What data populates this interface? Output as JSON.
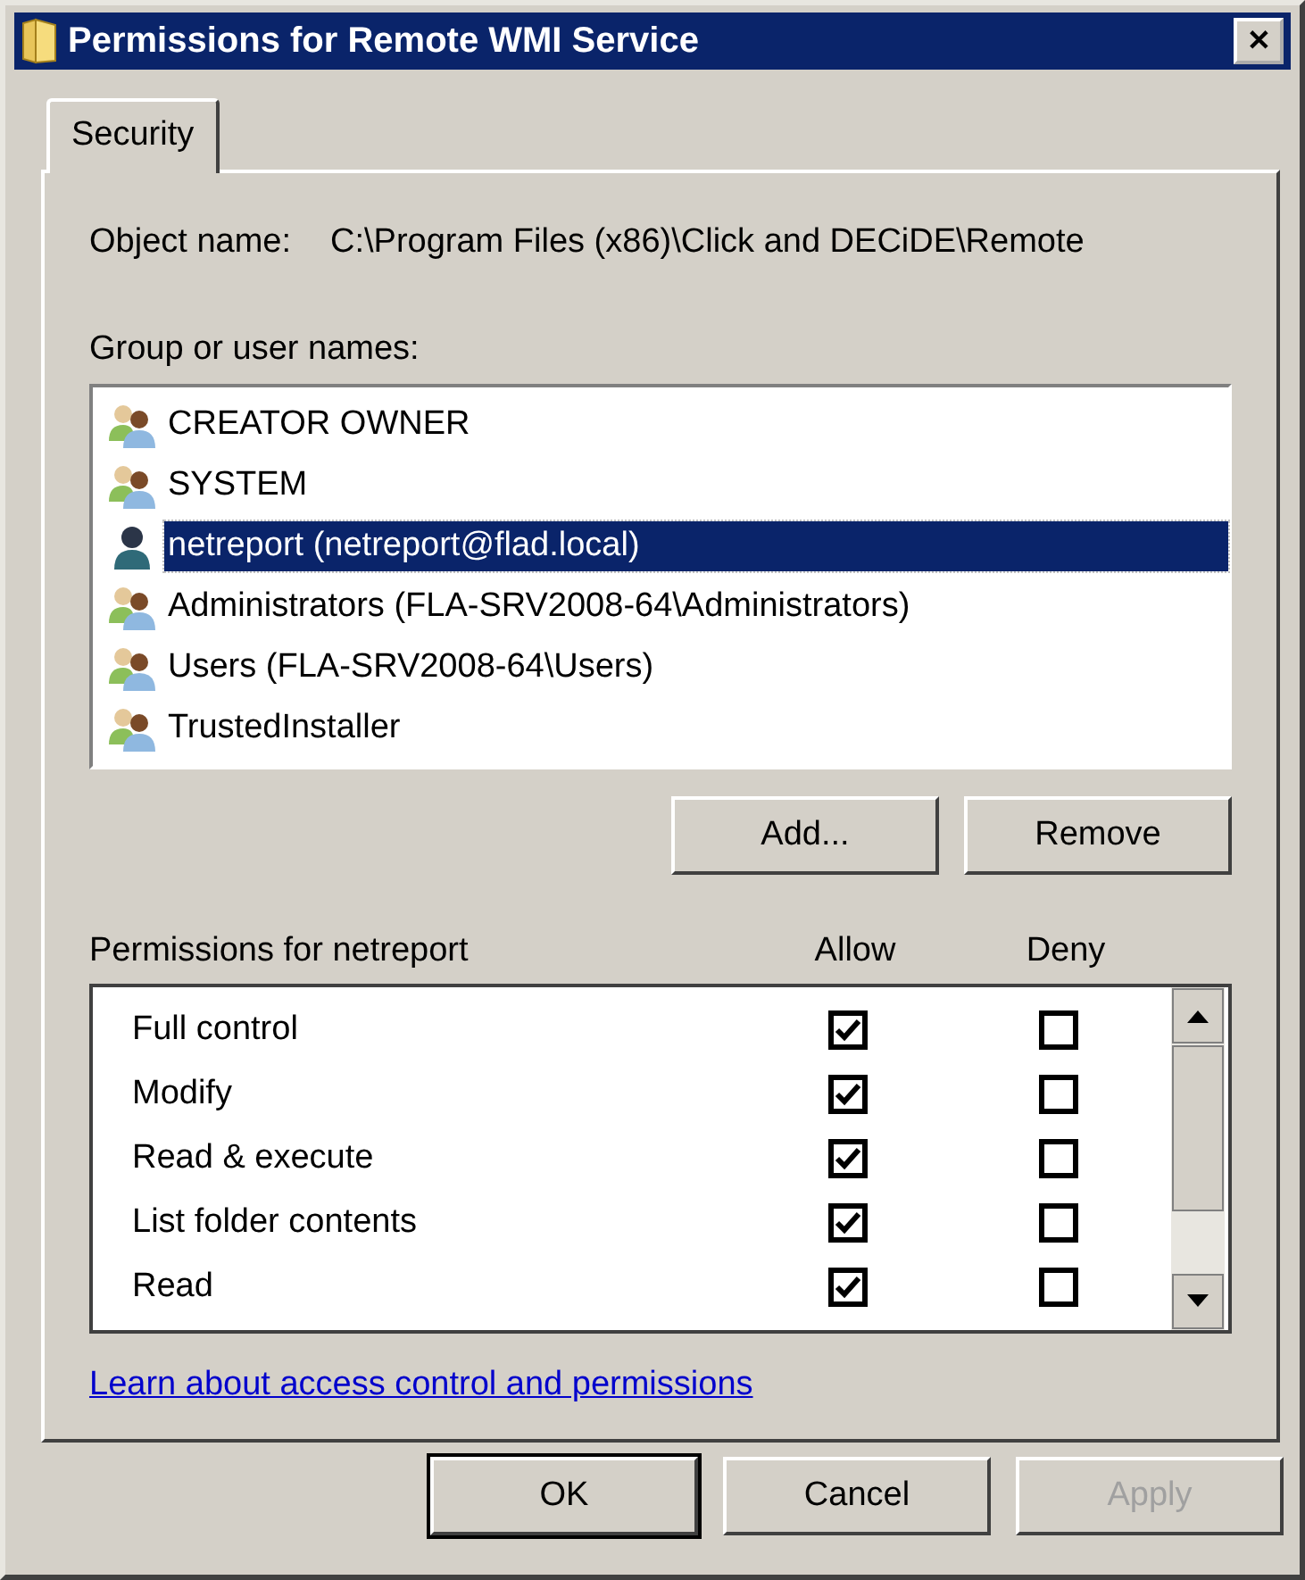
{
  "window": {
    "title": "Permissions for Remote WMI Service",
    "close": "✕"
  },
  "tabs": [
    {
      "label": "Security",
      "selected": true
    }
  ],
  "object_name": {
    "label": "Object name:",
    "value": "C:\\Program Files (x86)\\Click and DECiDE\\Remote"
  },
  "group_label": "Group or user names:",
  "principals": [
    {
      "kind": "group",
      "name": "CREATOR OWNER",
      "selected": false
    },
    {
      "kind": "group",
      "name": "SYSTEM",
      "selected": false
    },
    {
      "kind": "user",
      "name": "netreport (netreport@flad.local)",
      "selected": true
    },
    {
      "kind": "group",
      "name": "Administrators (FLA-SRV2008-64\\Administrators)",
      "selected": false
    },
    {
      "kind": "group",
      "name": "Users (FLA-SRV2008-64\\Users)",
      "selected": false
    },
    {
      "kind": "group",
      "name": "TrustedInstaller",
      "selected": false
    }
  ],
  "principal_buttons": [
    {
      "label": "Add...",
      "disabled": false
    },
    {
      "label": "Remove",
      "disabled": false
    }
  ],
  "permissions": {
    "label": "Permissions for netreport",
    "allow_header": "Allow",
    "deny_header": "Deny",
    "rows": [
      {
        "name": "Full control",
        "allow": true,
        "deny": false
      },
      {
        "name": "Modify",
        "allow": true,
        "deny": false
      },
      {
        "name": "Read & execute",
        "allow": true,
        "deny": false
      },
      {
        "name": "List folder contents",
        "allow": true,
        "deny": false
      },
      {
        "name": "Read",
        "allow": true,
        "deny": false
      }
    ]
  },
  "link": "Learn about access control and permissions",
  "buttons": [
    {
      "label": "OK",
      "default": true,
      "disabled": false
    },
    {
      "label": "Cancel",
      "default": false,
      "disabled": false
    },
    {
      "label": "Apply",
      "default": false,
      "disabled": true
    }
  ]
}
